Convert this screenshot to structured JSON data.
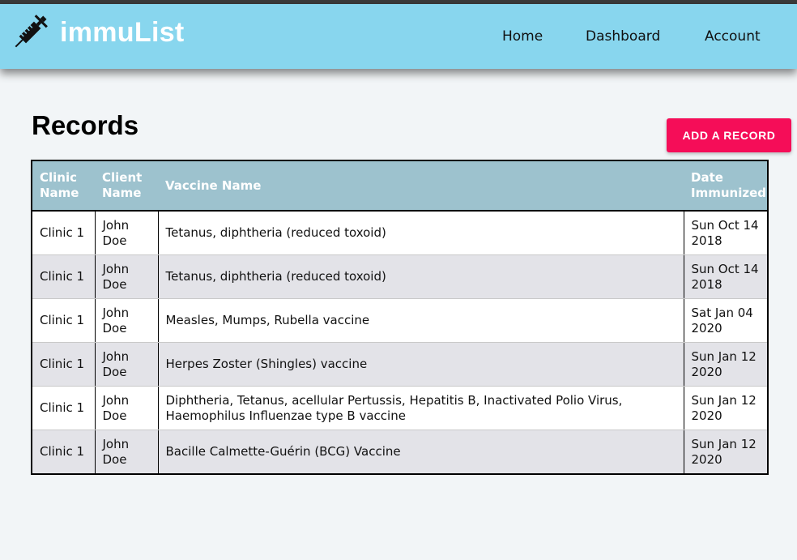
{
  "app": {
    "brand": "immuList",
    "nav": [
      {
        "label": "Home"
      },
      {
        "label": "Dashboard"
      },
      {
        "label": "Account"
      }
    ]
  },
  "page": {
    "title": "Records",
    "add_button_label": "ADD A RECORD"
  },
  "table": {
    "headers": [
      "Clinic Name",
      "Client Name",
      "Vaccine Name",
      "Date Immunized"
    ],
    "rows": [
      {
        "clinic": "Clinic 1",
        "client": "John Doe",
        "vaccine": "Tetanus, diphtheria (reduced toxoid)",
        "date": "Sun Oct 14 2018"
      },
      {
        "clinic": "Clinic 1",
        "client": "John Doe",
        "vaccine": "Tetanus, diphtheria (reduced toxoid)",
        "date": "Sun Oct 14 2018"
      },
      {
        "clinic": "Clinic 1",
        "client": "John Doe",
        "vaccine": "Measles, Mumps, Rubella vaccine",
        "date": "Sat Jan 04 2020"
      },
      {
        "clinic": "Clinic 1",
        "client": "John Doe",
        "vaccine": "Herpes Zoster (Shingles) vaccine",
        "date": "Sun Jan 12 2020"
      },
      {
        "clinic": "Clinic 1",
        "client": "John Doe",
        "vaccine": "Diphtheria, Tetanus, acellular Pertussis, Hepatitis B, Inactivated Polio Virus, Haemophilus Influenzae type B vaccine",
        "date": "Sun Jan 12 2020"
      },
      {
        "clinic": "Clinic 1",
        "client": "John Doe",
        "vaccine": "Bacille Calmette-Guérin (BCG) Vaccine",
        "date": "Sun Jan 12 2020"
      }
    ]
  },
  "colors": {
    "navbar": "#88d6ee",
    "accent_button": "#f50d58",
    "table_header": "#9dc2ce",
    "row_alt": "#e3e3e8"
  },
  "icons": {
    "logo": "syringe-icon"
  }
}
